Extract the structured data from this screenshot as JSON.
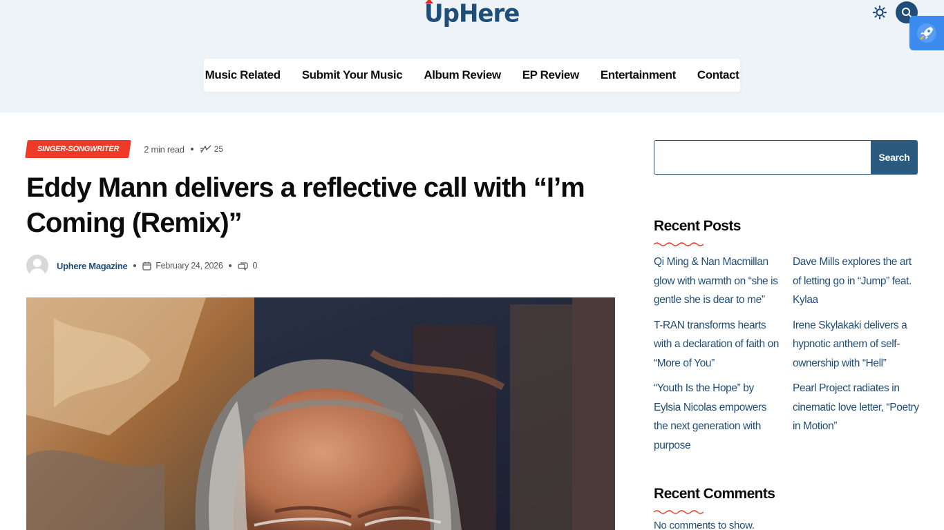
{
  "header": {
    "logo_text": "UpHere",
    "nav": [
      "Music Related",
      "Submit Your Music",
      "Album Review",
      "EP Review",
      "Entertainment",
      "Contact"
    ]
  },
  "article": {
    "category": "SINGER-SONGWRITER",
    "read_time": "2 min read",
    "views": "25",
    "title": "Eddy Mann delivers a reflective call with “I’m Coming (Remix)”",
    "author": "Uphere Magazine",
    "date": "February 24, 2026",
    "comments": "0"
  },
  "sidebar": {
    "search_button": "Search",
    "search_value": "",
    "recent_posts_title": "Recent Posts",
    "recent_posts": [
      "Qi Ming & Nan Macmillan glow with warmth on “she is gentle she is dear to me”",
      "Dave Mills explores the art of letting go in “Jump” feat. Kylaa",
      "T-RAN transforms hearts with a declaration of faith on “More of You”",
      "Irene Skylakaki delivers a hypnotic anthem of self-ownership with “Hell”",
      "“Youth Is the Hope” by Eylsia Nicolas empowers the next generation with purpose",
      "Pearl Project radiates in cinematic love letter, “Poetry in Motion”"
    ],
    "recent_comments_title": "Recent Comments",
    "no_comments_text": "No comments to show."
  },
  "colors": {
    "brand": "#1f4e79",
    "accent": "#ee3a26",
    "header_bg": "#eef3f8",
    "rocket_bg": "#3c8cf0"
  },
  "icons": [
    "sun-icon",
    "search-icon",
    "rocket-icon",
    "views-icon",
    "calendar-icon",
    "comment-icon"
  ]
}
